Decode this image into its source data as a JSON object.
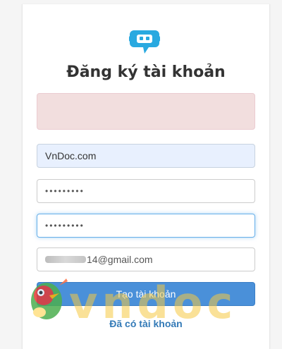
{
  "form": {
    "title": "Đăng ký tài khoản",
    "username_value": "VnDoc.com",
    "password_value": "•••••••••",
    "confirm_password_value": "•••••••••",
    "email_visible_value": "14@gmail.com",
    "submit_label": "Tạo tài khoản",
    "login_link": "Đã có tài khoản"
  },
  "watermark": {
    "text": "vndoc",
    "color": "#f5c842"
  },
  "colors": {
    "primary_button": "#4a90d9",
    "link": "#337ab7",
    "alert_background": "#f2dede",
    "autofill_background": "#e8f0fe",
    "logo": "#29a9e0"
  },
  "icons": {
    "logo": "chat-bubble-bot-icon"
  }
}
